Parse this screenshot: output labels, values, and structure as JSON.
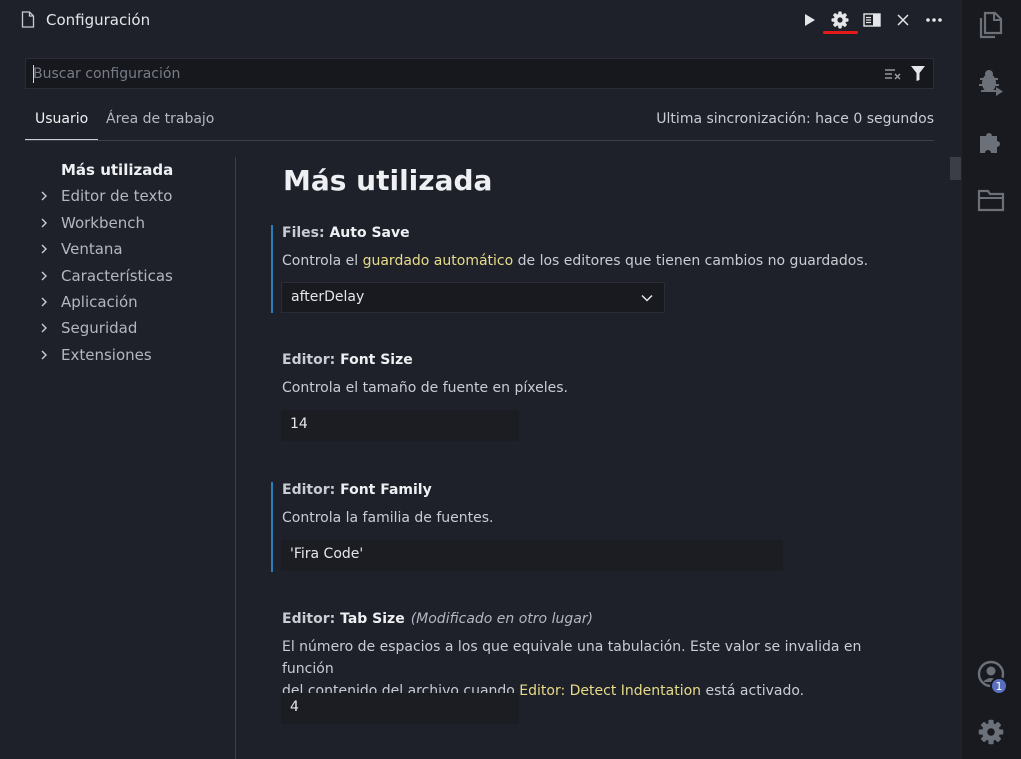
{
  "tab": {
    "title": "Configuración"
  },
  "search": {
    "placeholder": "Buscar configuración",
    "value": ""
  },
  "scope": {
    "tabs": [
      {
        "label": "Usuario"
      },
      {
        "label": "Área de trabajo"
      }
    ],
    "sync_status": "Ultima sincronización: hace 0 segundos"
  },
  "toc": {
    "items": [
      {
        "label": "Más utilizada"
      },
      {
        "label": "Editor de texto"
      },
      {
        "label": "Workbench"
      },
      {
        "label": "Ventana"
      },
      {
        "label": "Características"
      },
      {
        "label": "Aplicación"
      },
      {
        "label": "Seguridad"
      },
      {
        "label": "Extensiones"
      }
    ]
  },
  "content": {
    "section_title": "Más utilizada",
    "settings": [
      {
        "category": "Files: ",
        "key": "Auto Save",
        "desc_before": "Controla el ",
        "desc_link": "guardado automático",
        "desc_after": " de los editores que tienen cambios no guardados.",
        "value": "afterDelay"
      },
      {
        "category": "Editor: ",
        "key": "Font Size",
        "desc": "Controla el tamaño de fuente en píxeles.",
        "value": "14"
      },
      {
        "category": "Editor: ",
        "key": "Font Family",
        "desc": "Controla la familia de fuentes.",
        "value": "'Fira Code'"
      },
      {
        "category": "Editor: ",
        "key": "Tab Size",
        "modified": "(Modificado en otro lugar)",
        "desc_line1": "El número de espacios a los que equivale una tabulación. Este valor se invalida en función",
        "desc_line2_before": "del contenido del archivo cuando ",
        "desc_link": "Editor: Detect Indentation",
        "desc_line2_after": " está activado.",
        "value": "4"
      }
    ]
  },
  "activity_bar": {
    "icons": [
      "explorer-icon",
      "run-debug-icon",
      "extensions-icon",
      "folder-icon",
      "accounts-icon",
      "manage-gear-icon"
    ],
    "accounts_badge": "1"
  },
  "colors": {
    "background": "#1e2129",
    "activity_bar": "#181a1f",
    "link": "#e8dc8a",
    "focus_bar": "#2a7fba",
    "gear_underline": "#e51b1b"
  }
}
